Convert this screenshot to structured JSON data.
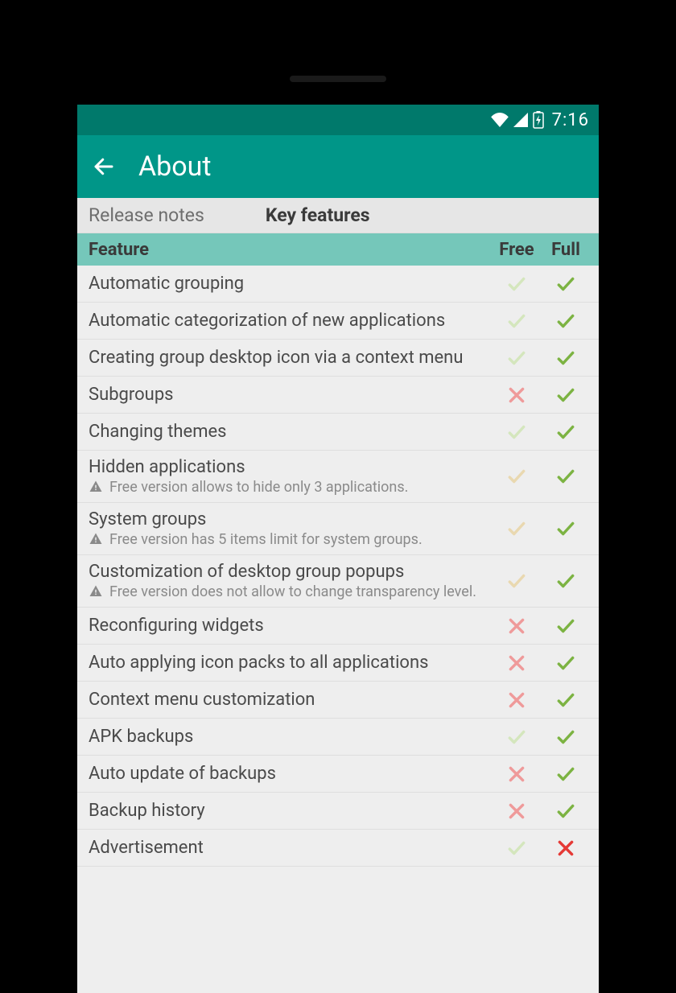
{
  "status_bar": {
    "time": "7:16"
  },
  "toolbar": {
    "title": "About"
  },
  "tabs": {
    "release_notes": "Release notes",
    "key_features": "Key features"
  },
  "table_header": {
    "feature": "Feature",
    "free": "Free",
    "full": "Full"
  },
  "features": [
    {
      "label": "Automatic grouping",
      "free": "check-light",
      "full": "check-green"
    },
    {
      "label": "Automatic categorization of new applications",
      "free": "check-light",
      "full": "check-green"
    },
    {
      "label": "Creating group desktop icon via a context menu",
      "free": "check-light",
      "full": "check-green"
    },
    {
      "label": "Subgroups",
      "free": "cross-pink",
      "full": "check-green"
    },
    {
      "label": "Changing themes",
      "free": "check-light",
      "full": "check-green"
    },
    {
      "label": "Hidden applications",
      "note": "Free version allows to hide only 3 applications.",
      "free": "check-tan",
      "full": "check-green"
    },
    {
      "label": "System groups",
      "note": "Free version has 5 items limit for system groups.",
      "free": "check-tan",
      "full": "check-green"
    },
    {
      "label": "Customization of desktop group popups",
      "note": "Free version does not allow to change transparency level.",
      "free": "check-tan",
      "full": "check-green"
    },
    {
      "label": "Reconfiguring widgets",
      "free": "cross-pink",
      "full": "check-green"
    },
    {
      "label": "Auto applying icon packs to all applications",
      "free": "cross-pink",
      "full": "check-green"
    },
    {
      "label": "Context menu customization",
      "free": "cross-pink",
      "full": "check-green"
    },
    {
      "label": "APK backups",
      "free": "check-light",
      "full": "check-green"
    },
    {
      "label": "Auto update of backups",
      "free": "cross-pink",
      "full": "check-green"
    },
    {
      "label": "Backup history",
      "free": "cross-pink",
      "full": "check-green"
    },
    {
      "label": "Advertisement",
      "free": "check-light",
      "full": "cross-red"
    }
  ]
}
